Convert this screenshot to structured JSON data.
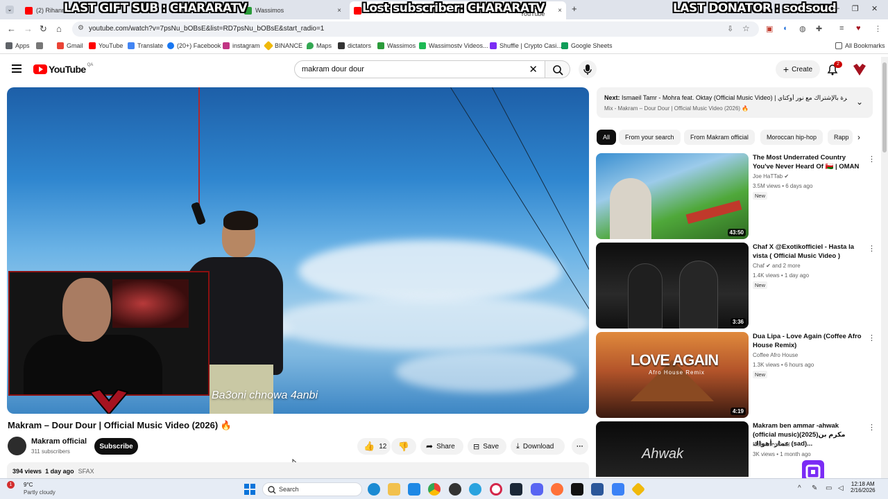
{
  "browser": {
    "tabs": [
      {
        "label": "(2) Rihanna",
        "fav_color": "#ff0000"
      },
      {
        "label": "Wassimos",
        "fav_color": "#2b9b3a"
      },
      {
        "label": "SOLO - YouTube",
        "fav_color": "#ff0000"
      }
    ],
    "new_tab": "+",
    "tab_close": "×",
    "overlays": {
      "gift_sub": "LAST GIFT SUB : CHARARATV",
      "lost_sub": "Lost subscriber: CHARARATV",
      "donator": "LAST DONATOR : sodsoud"
    },
    "url": "youtube.com/watch?v=7psNu_bOBsE&list=RD7psNu_bOBsE&start_radio=1",
    "bookmarks": [
      {
        "label": "Apps",
        "color": "#5f6368"
      },
      {
        "label": "Gmail",
        "color": "#ea4335"
      },
      {
        "label": "YouTube",
        "color": "#ff0000"
      },
      {
        "label": "Translate",
        "color": "#4285f4"
      },
      {
        "label": "(20+) Facebook",
        "color": "#1877f2"
      },
      {
        "label": "instagram",
        "color": "#c13584"
      },
      {
        "label": "BINANCE",
        "color": "#f0b90b"
      },
      {
        "label": "Maps",
        "color": "#34a853"
      },
      {
        "label": "dictators",
        "color": "#333333"
      },
      {
        "label": "Wassimos",
        "color": "#2b9b3a"
      },
      {
        "label": "Wassimostv Videos...",
        "color": "#1db954"
      },
      {
        "label": "Shuffle | Crypto Casi...",
        "color": "#7b2cf5"
      },
      {
        "label": "Google Sheets",
        "color": "#0f9d58"
      }
    ],
    "all_bookmarks": "All Bookmarks"
  },
  "youtube": {
    "logo_text": "YouTube",
    "logo_country": "QA",
    "search_value": "makram dour dour",
    "create_label": "Create",
    "notification_count": "2",
    "video": {
      "lyric": "Ba3oni chnowa 4anbi",
      "title": "Makram – Dour Dour | Official Music Video (2026) 🔥",
      "channel": "Makram official",
      "subscribers": "311 subscribers",
      "subscribe_label": "Subscribe",
      "likes": "12",
      "share_label": "Share",
      "save_label": "Save",
      "download_label": "Download",
      "views": "394 views",
      "age": "1 day ago",
      "tag": "SFAX"
    },
    "up_next": {
      "prefix": "Next:",
      "title": "Ismaeil Tamr - Mohra feat. Oktay (Official Music Video) | مهرة بالإشتراك مع نور أوكتاي",
      "mix": "Mix - Makram – Dour Dour | Official Music Video (2026) 🔥"
    },
    "chips": [
      "All",
      "From your search",
      "From Makram official",
      "Moroccan hip-hop",
      "Rapp"
    ],
    "recommendations": [
      {
        "title": "The Most Underrated Country You've Never Heard Of 🇴🇲 | OMAN",
        "channel": "Joe HaTTab ✔",
        "meta": "3.5M views • 6 days ago",
        "badge": "New",
        "duration": "43:50",
        "c1": "#3a8fd1",
        "c2": "#4fa83a"
      },
      {
        "title": "Chaf X @Exotikofficiel - Hasta la vista ( Official Music Video )",
        "channel": "Chaf ✔ and 2 more",
        "meta": "1.4K views • 1 day ago",
        "badge": "New",
        "duration": "3:36",
        "c1": "#1a1a1a",
        "c2": "#3a3a3a"
      },
      {
        "title": "Dua Lipa - Love Again (Coffee Afro House Remix)",
        "channel": "Coffee Afro House",
        "meta": "1.3K views • 6 hours ago",
        "badge": "New",
        "duration": "4:19",
        "c1": "#d3742e",
        "c2": "#5a2a18"
      },
      {
        "title": "Makram ben ammar -ahwak (official music)(2025)مكرم بن عمار-أهواك (sad)...",
        "channel": "Makram official",
        "meta": "3K views • 1 month ago",
        "badge": "",
        "duration": "",
        "c1": "#111111",
        "c2": "#2a2a2a"
      }
    ]
  },
  "taskbar": {
    "temp": "9°C",
    "condition": "Partly cloudy",
    "search_placeholder": "Search",
    "time": "12:18 AM",
    "date": "2/16/2026"
  }
}
